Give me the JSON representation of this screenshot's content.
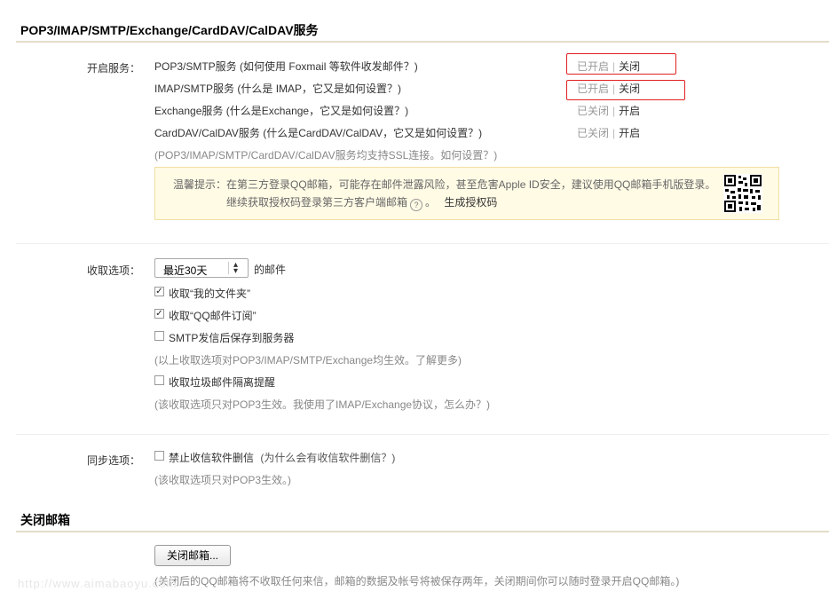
{
  "header": {
    "title": "POP3/IMAP/SMTP/Exchange/CardDAV/CalDAV服务"
  },
  "services": {
    "label": "开启服务：",
    "items": [
      {
        "name": "POP3/SMTP服务",
        "help": "(如何使用 Foxmail 等软件收发邮件？)",
        "status": "已开启",
        "action": "关闭"
      },
      {
        "name": "IMAP/SMTP服务",
        "help": "(什么是 IMAP，它又是如何设置？)",
        "status": "已开启",
        "action": "关闭"
      },
      {
        "name": "Exchange服务",
        "help": "(什么是Exchange，它又是如何设置？)",
        "status": "已关闭",
        "action": "开启"
      },
      {
        "name": "CardDAV/CalDAV服务",
        "help": "(什么是CardDAV/CalDAV，它又是如何设置？)",
        "status": "已关闭",
        "action": "开启"
      }
    ],
    "ssl_note": "(POP3/IMAP/SMTP/CardDAV/CalDAV服务均支持SSL连接。如何设置？)",
    "tip_line1": "温馨提示：在第三方登录QQ邮箱，可能存在邮件泄露风险，甚至危害Apple ID安全，建议使用QQ邮箱手机版登录。",
    "tip_line2_a": "继续获取授权码登录第三方客户端邮箱",
    "tip_help_icon": "?",
    "tip_line2_b": "。",
    "tip_link": "生成授权码"
  },
  "receive": {
    "label": "收取选项：",
    "range_value": "最近30天",
    "range_suffix": "的邮件",
    "opt_folder": "收取“我的文件夹”",
    "opt_subscription": "收取“QQ邮件订阅”",
    "opt_smtp_save": "SMTP发信后保存到服务器",
    "note1": "(以上收取选项对POP3/IMAP/SMTP/Exchange均生效。了解更多)",
    "opt_spam": "收取垃圾邮件隔离提醒",
    "note2": "(该收取选项只对POP3生效。我使用了IMAP/Exchange协议，怎么办？)"
  },
  "sync": {
    "label": "同步选项：",
    "opt_no_delete": "禁止收信软件删信",
    "opt_no_delete_help": "(为什么会有收信软件删信？)",
    "note": "(该收取选项只对POP3生效。)"
  },
  "close_mailbox": {
    "title": "关闭邮箱",
    "button": "关闭邮箱...",
    "note": "(关闭后的QQ邮箱将不收取任何来信，邮箱的数据及帐号将被保存两年，关闭期间你可以随时登录开启QQ邮箱。)"
  },
  "watermark": "http://www.aimabaoyu.com",
  "colors": {
    "highlight_box": "#e02020",
    "tip_bg": "#fffbe5",
    "section_line": "#e4dcc8"
  }
}
